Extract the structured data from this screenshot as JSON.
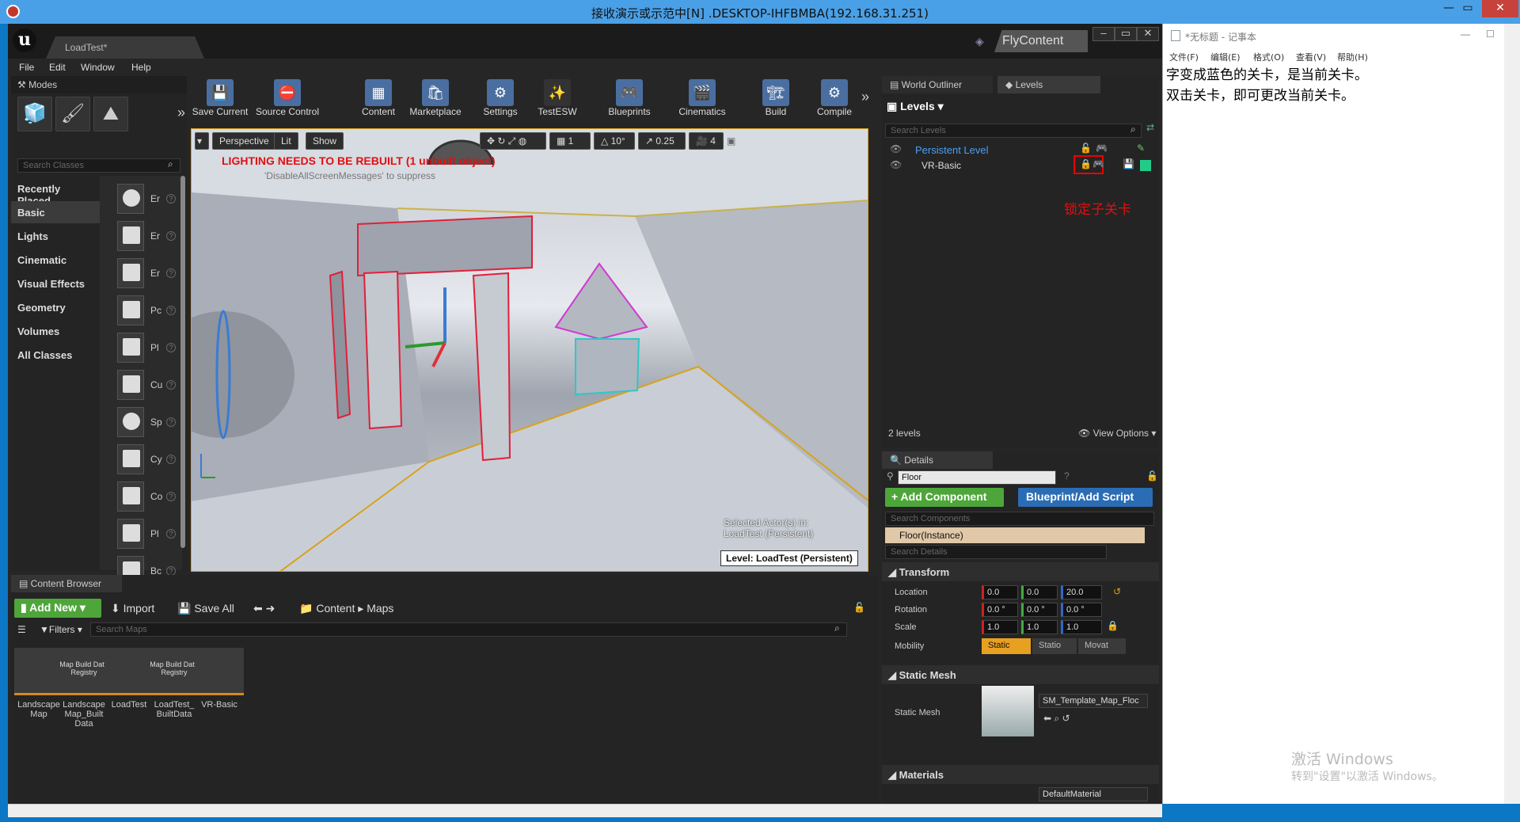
{
  "window": {
    "title": "接收演示或示范中[N] .DESKTOP-IHFBMBA(192.168.31.251)"
  },
  "ue": {
    "doc_tab": "LoadTest*",
    "fly_content": "FlyContent",
    "menu": [
      "File",
      "Edit",
      "Window",
      "Help"
    ],
    "modes": {
      "title": "Modes",
      "search_placeholder": "Search Classes",
      "categories": [
        "Recently Placed",
        "Basic",
        "Lights",
        "Cinematic",
        "Visual Effects",
        "Geometry",
        "Volumes",
        "All Classes"
      ],
      "place_items": [
        "Er",
        "Er",
        "Er",
        "Pc",
        "Pl",
        "Cu",
        "Sp",
        "Cy",
        "Co",
        "Pl",
        "Bc"
      ]
    },
    "toolbar": [
      "Save Current",
      "Source Control",
      "Content",
      "Marketplace",
      "Settings",
      "TestESW",
      "Blueprints",
      "Cinematics",
      "Build",
      "Compile"
    ],
    "viewport": {
      "perspective": "Perspective",
      "lit": "Lit",
      "show": "Show",
      "grid_num": "1",
      "angle": "10°",
      "scale": "0.25",
      "cam_speed": "4",
      "warning": "LIGHTING NEEDS TO BE REBUILT (1 unbuilt object)",
      "warning_sub": "'DisableAllScreenMessages' to suppress",
      "selected_line1": "Selected Actor(s) in:",
      "selected_line2": "LoadTest (Persistent)",
      "level_label": "Level:  LoadTest (Persistent)"
    },
    "outliner": {
      "tab_outliner": "World Outliner",
      "tab_levels": "Levels",
      "levels_menu": "Levels",
      "search_placeholder": "Search Levels",
      "levels": [
        "Persistent Level",
        "VR-Basic"
      ],
      "annotation": "锁定子关卡",
      "count": "2 levels",
      "view_options": "View Options"
    },
    "details": {
      "tab": "Details",
      "name": "Floor",
      "add_component": "+ Add Component",
      "blueprint": "Blueprint/Add Script",
      "search_components": "Search Components",
      "instance": "Floor(Instance)",
      "search_details": "Search Details",
      "transform": "Transform",
      "location_label": "Location",
      "rotation_label": "Rotation",
      "scale_label": "Scale",
      "mobility_label": "Mobility",
      "location": [
        "0.0",
        "0.0",
        "20.0"
      ],
      "rotation": [
        "0.0 °",
        "0.0 °",
        "0.0 °"
      ],
      "scale": [
        "1.0",
        "1.0",
        "1.0"
      ],
      "mobility": [
        "Static",
        "Statio",
        "Movat"
      ],
      "static_mesh_section": "Static Mesh",
      "static_mesh_label": "Static Mesh",
      "static_mesh_value": "SM_Template_Map_Floc",
      "materials_section": "Materials",
      "material_value": "DefaultMaterial"
    },
    "content_browser": {
      "tab": "Content Browser",
      "add_new": "Add New",
      "import": "Import",
      "save_all": "Save All",
      "path": [
        "Content",
        "Maps"
      ],
      "filters": "Filters",
      "search_placeholder": "Search Maps",
      "assets": [
        {
          "label": "Landscape Map",
          "thumb": ""
        },
        {
          "label": "Landscape Map_Built Data",
          "thumb": "Map Build Data Registry"
        },
        {
          "label": "LoadTest",
          "thumb": ""
        },
        {
          "label": "LoadTest_ BuiltData",
          "thumb": "Map Build Data Registry"
        },
        {
          "label": "VR-Basic",
          "thumb": ""
        }
      ]
    }
  },
  "notepad": {
    "title": "*无标题 - 记事本",
    "menu": [
      "文件(F)",
      "编辑(E)",
      "格式(O)",
      "查看(V)",
      "帮助(H)"
    ],
    "text": "字变成蓝色的关卡，是当前关卡。\n双击关卡，即可更改当前关卡。",
    "watermark1": "激活 Windows",
    "watermark2": "转到\"设置\"以激活 Windows。"
  },
  "colors": {
    "accent_green": "#4ea63a",
    "accent_blue": "#2b6db5",
    "warning_red": "#e01010",
    "selection_orange": "#d9a21a"
  }
}
